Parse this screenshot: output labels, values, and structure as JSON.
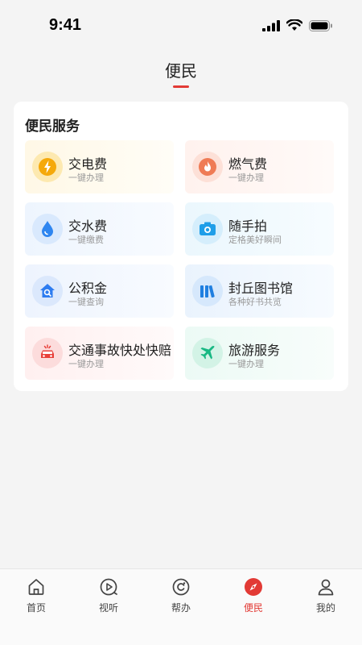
{
  "status": {
    "time": "9:41"
  },
  "header": {
    "title": "便民"
  },
  "card": {
    "title": "便民服务",
    "items": [
      {
        "title": "交电费",
        "subtitle": "一键办理",
        "icon": "lightning-icon"
      },
      {
        "title": "燃气费",
        "subtitle": "一键办理",
        "icon": "flame-icon"
      },
      {
        "title": "交水费",
        "subtitle": "一键缴费",
        "icon": "water-drop-icon"
      },
      {
        "title": "随手拍",
        "subtitle": "定格美好瞬间",
        "icon": "camera-icon"
      },
      {
        "title": "公积金",
        "subtitle": "一键查询",
        "icon": "house-search-icon"
      },
      {
        "title": "封丘图书馆",
        "subtitle": "各种好书共览",
        "icon": "books-icon"
      },
      {
        "title": "交通事故快处快赔",
        "subtitle": "一键办理",
        "icon": "car-accident-icon"
      },
      {
        "title": "旅游服务",
        "subtitle": "一键办理",
        "icon": "airplane-icon"
      }
    ]
  },
  "nav": {
    "items": [
      {
        "label": "首页",
        "icon": "home-icon"
      },
      {
        "label": "视听",
        "icon": "play-icon"
      },
      {
        "label": "帮办",
        "icon": "help-icon"
      },
      {
        "label": "便民",
        "icon": "compass-icon"
      },
      {
        "label": "我的",
        "icon": "user-icon"
      }
    ],
    "active_index": 3
  },
  "colors": {
    "accent": "#e23a35"
  }
}
